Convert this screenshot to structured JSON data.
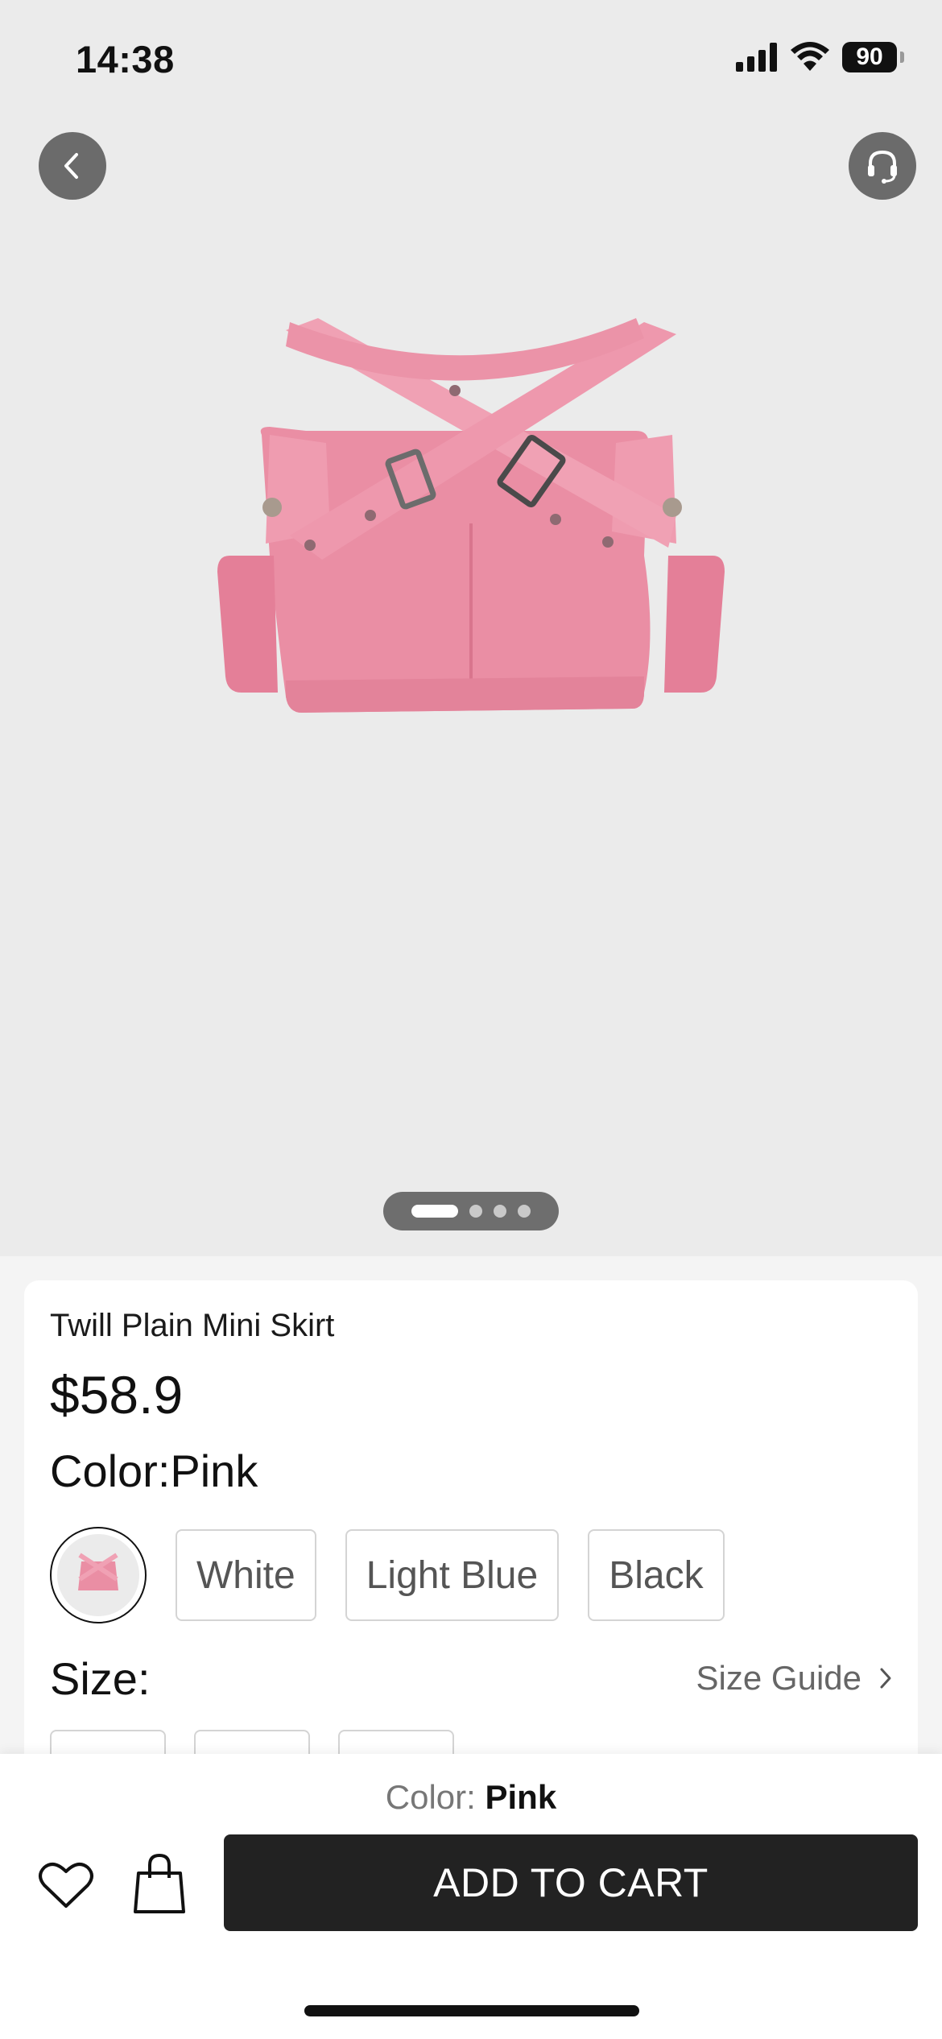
{
  "status_bar": {
    "time": "14:38",
    "battery": "90"
  },
  "nav": {
    "back_icon": "chevron-left-icon",
    "support_icon": "headset-icon"
  },
  "gallery": {
    "image_count": 4,
    "active_index": 0
  },
  "product": {
    "title": "Twill Plain Mini Skirt",
    "price": "$58.9",
    "color_label": "Color:Pink",
    "colors": [
      "White",
      "Light Blue",
      "Black"
    ],
    "selected_color": "Pink",
    "size_label": "Size:",
    "size_guide": "Size Guide"
  },
  "bottom_bar": {
    "color_key": "Color:",
    "color_value": "Pink",
    "add_to_cart": "ADD TO CART"
  },
  "colors": {
    "skirt_pink": "#e9899f",
    "button_dark": "#222222",
    "hero_bg": "#ebebeb"
  }
}
